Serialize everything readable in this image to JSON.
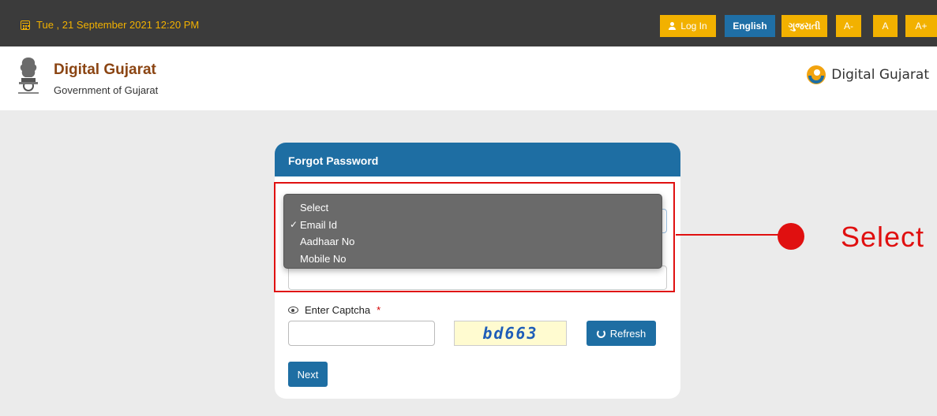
{
  "topbar": {
    "datetime": "Tue , 21 September 2021 12:20 PM",
    "login_label": "Log In",
    "english_label": "English",
    "gujarati_label": "ગુજરાતી",
    "font_decrease": "A-",
    "font_normal": "A",
    "font_increase": "A+"
  },
  "header": {
    "title": "Digital Gujarat",
    "subtitle": "Government of Gujarat",
    "logo_text": "Digital Gujarat"
  },
  "card": {
    "title": "Forgot Password",
    "captcha_label": "Enter Captcha",
    "required_mark": "*",
    "captcha_text": "bd663",
    "refresh_label": "Refresh",
    "next_label": "Next"
  },
  "dropdown": {
    "options": [
      {
        "label": "Select",
        "checked": false
      },
      {
        "label": "Email Id",
        "checked": true
      },
      {
        "label": "Aadhaar No",
        "checked": false
      },
      {
        "label": "Mobile No",
        "checked": false
      }
    ],
    "check_glyph": "✓"
  },
  "annotation": {
    "label": "Select",
    "color": "#e01010"
  },
  "colors": {
    "topbar_bg": "#3b3b3b",
    "accent_yellow": "#f2b100",
    "primary_blue": "#1e6ea3",
    "brand_brown": "#8b4513"
  }
}
